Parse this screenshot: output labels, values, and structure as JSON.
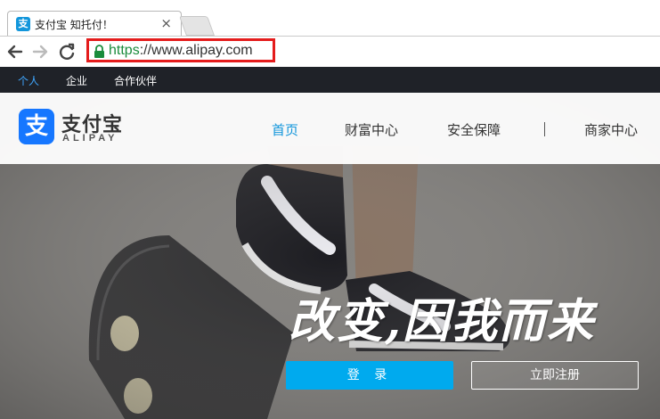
{
  "browser": {
    "tab_title": "支付宝 知托付！",
    "tab_close": "×",
    "favicon_glyph": "支",
    "url_scheme": "https",
    "url_rest": "://www.alipay.com",
    "highlight_color": "#e41c1c"
  },
  "topnav": {
    "items": [
      "个人",
      "企业",
      "合作伙伴"
    ],
    "active_color": "#3fa7ff"
  },
  "header": {
    "logo_glyph": "支",
    "logo_cn": "支付宝",
    "logo_en": "ALIPAY",
    "nav": [
      "首页",
      "财富中心",
      "安全保障",
      "商家中心"
    ],
    "brand_color": "#1296db"
  },
  "hero": {
    "slogan": "改变,因我而来",
    "login_label": "登 录",
    "register_label": "立即注册",
    "button_color": "#00aaee"
  }
}
